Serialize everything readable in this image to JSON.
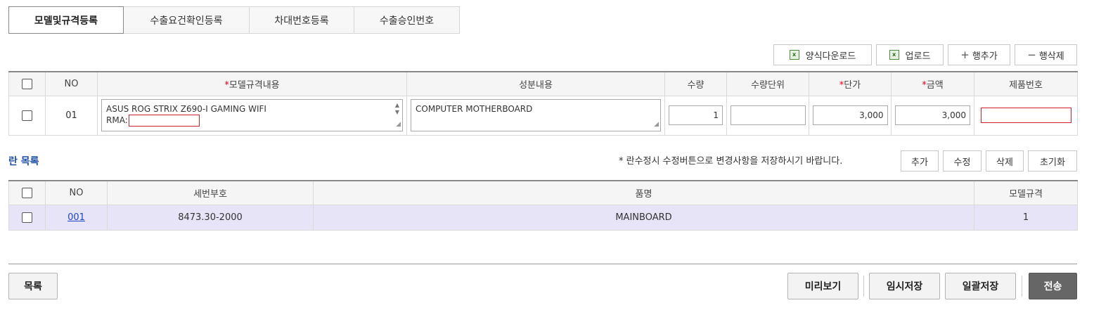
{
  "tabs": [
    "모델및규격등록",
    "수출요건확인등록",
    "차대번호등록",
    "수출승인번호"
  ],
  "toolbar1": {
    "template_download": "양식다운로드",
    "upload": "업로드",
    "add_row": "행추가",
    "delete_row": "행삭제"
  },
  "table1": {
    "headers": {
      "no": "NO",
      "model_spec": "모델규격내용",
      "component": "성분내용",
      "qty": "수량",
      "qty_unit": "수량단위",
      "unit_price": "단가",
      "amount": "금액",
      "product_no": "제품번호"
    },
    "required_mark": "*",
    "rows": [
      {
        "no": "01",
        "model_spec_line1": "ASUS ROG STRIX Z690-I GAMING WIFI",
        "rma_label": "RMA:",
        "component": "COMPUTER MOTHERBOARD",
        "qty": "1",
        "qty_unit": "",
        "unit_price": "3,000",
        "amount": "3,000",
        "product_no": ""
      }
    ]
  },
  "section": {
    "title": "란 목록",
    "note": "* 란수정시 수정버튼으로 변경사항을 저장하시기 바랍니다.",
    "buttons": {
      "add": "추가",
      "edit": "수정",
      "delete": "삭제",
      "reset": "초기화"
    }
  },
  "table2": {
    "headers": {
      "no": "NO",
      "hs_code": "세번부호",
      "item_name": "품명",
      "model_spec": "모델규격"
    },
    "rows": [
      {
        "no": "001",
        "hs_code": "8473.30-2000",
        "item_name": "MAINBOARD",
        "model_spec": "1"
      }
    ]
  },
  "footer": {
    "list": "목록",
    "preview": "미리보기",
    "temp_save": "임시저장",
    "bulk_save": "일괄저장",
    "send": "전송"
  },
  "colors": {
    "accent_blue": "#1e4fa3",
    "required_red": "#e60012",
    "selected_row": "#e8e4f7"
  }
}
